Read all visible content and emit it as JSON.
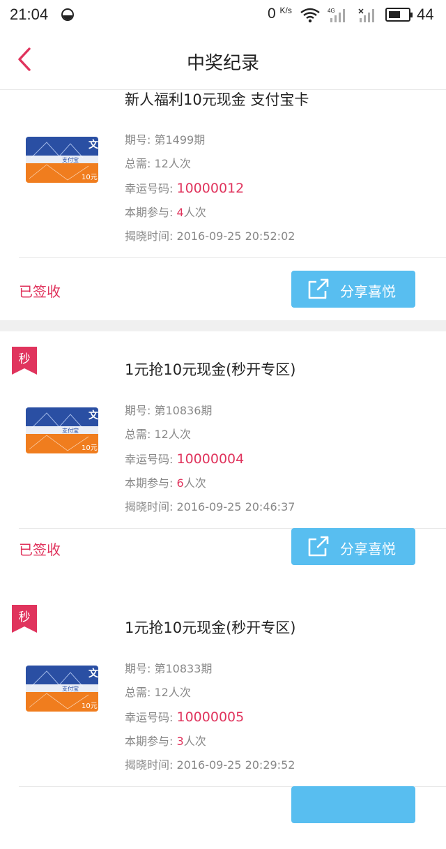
{
  "status_bar": {
    "time": "21:04",
    "net_speed": "0",
    "net_unit": "K/s",
    "network_type": "4G",
    "battery_level": "44"
  },
  "header": {
    "title": "中奖纪录",
    "back_icon": "chevron-left-icon",
    "accent": "#e0345d"
  },
  "labels": {
    "period": "期号:",
    "total": "总需:",
    "lucky": "幸运号码:",
    "join": "本期参与:",
    "time": "揭晓时间:",
    "unit_times": "人次",
    "share": "分享喜悦",
    "sec_badge": "秒"
  },
  "records": [
    {
      "title": "新人福利10元现金 支付宝卡",
      "period": "第1499期",
      "total": "12人次",
      "lucky_number": "10000012",
      "joined": "4",
      "reveal_time": "2016-09-25 20:52:02",
      "status": "已签收",
      "badge": false
    },
    {
      "title": "1元抢10元现金(秒开专区)",
      "period": "第10836期",
      "total": "12人次",
      "lucky_number": "10000004",
      "joined": "6",
      "reveal_time": "2016-09-25 20:46:37",
      "status": "已签收",
      "badge": true
    },
    {
      "title": "1元抢10元现金(秒开专区)",
      "period": "第10833期",
      "total": "12人次",
      "lucky_number": "10000005",
      "joined": "3",
      "reveal_time": "2016-09-25 20:29:52",
      "status": "",
      "badge": true
    }
  ],
  "card_image": {
    "brand": "支付宝",
    "value": "10元",
    "colors": {
      "top": "#2a4fa3",
      "bottom": "#f07d1e"
    }
  },
  "colors": {
    "accent_red": "#e0345d",
    "share_blue": "#58bef0",
    "muted": "#888888"
  }
}
